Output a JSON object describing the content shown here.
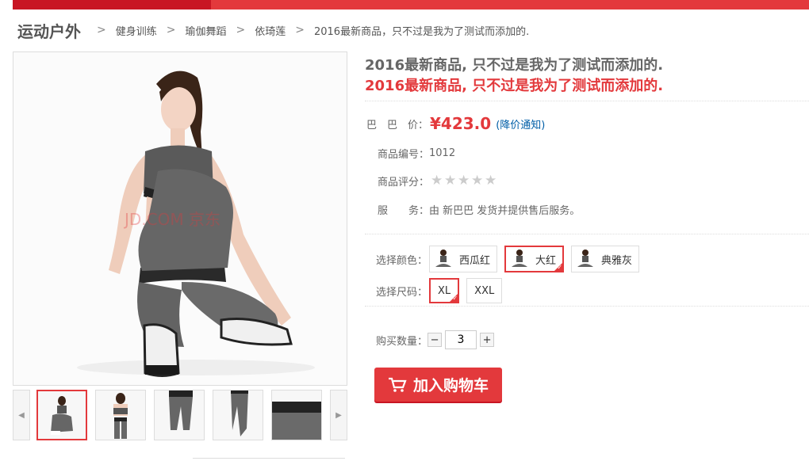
{
  "breadcrumb": {
    "root": "运动户外",
    "separator": ">",
    "items": [
      "健身训练",
      "瑜伽舞蹈",
      "依琦莲"
    ],
    "current": "2016最新商品，只不过是我为了测试而添加的."
  },
  "image": {
    "watermark": "JD.COM 京东",
    "thumbnail_count": 5,
    "selected_thumbnail": 1
  },
  "product": {
    "title": "2016最新商品, 只不过是我为了测试而添加的.",
    "subtitle": "2016最新商品, 只不过是我为了测试而添加的."
  },
  "price": {
    "label": "巴　巴　价：",
    "value": "¥423.0",
    "notify": "(降价通知)"
  },
  "info": {
    "code_label": "商品编号：",
    "code_value": "1012",
    "rating_label": "商品评分：",
    "rating_value": 0,
    "rating_max": 5,
    "service_label": "服　　务：",
    "service_value": "由 新巴巴 发货并提供售后服务。"
  },
  "color": {
    "label": "选择颜色：",
    "options": [
      "西瓜红",
      "大红",
      "典雅灰"
    ],
    "selected": "大红"
  },
  "size": {
    "label": "选择尺码：",
    "options": [
      "XL",
      "XXL"
    ],
    "selected": "XL"
  },
  "quantity": {
    "label": "购买数量：",
    "minus": "−",
    "value": "3",
    "plus": "+"
  },
  "cart": {
    "label": "加入购物车"
  },
  "colors": {
    "accent": "#e3393c",
    "accent_dark": "#c81623",
    "link": "#005ea7"
  }
}
